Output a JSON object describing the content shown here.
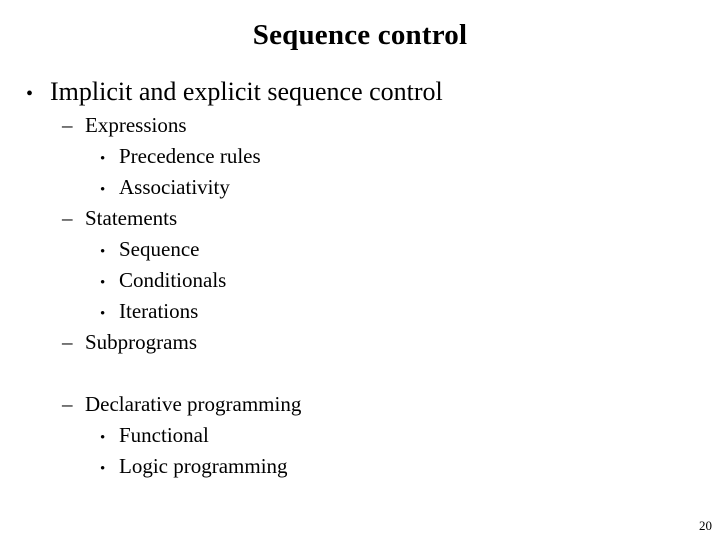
{
  "slide": {
    "title": "Sequence control",
    "page_number": "20",
    "markers": {
      "level1": "•",
      "level2": "–",
      "level3": "•"
    },
    "colors": {
      "background": "#ffffff",
      "text": "#000000"
    },
    "outline": [
      {
        "level": 1,
        "text": "Implicit and explicit sequence control"
      },
      {
        "level": 2,
        "text": "Expressions"
      },
      {
        "level": 3,
        "text": "Precedence rules"
      },
      {
        "level": 3,
        "text": "Associativity"
      },
      {
        "level": 2,
        "text": "Statements"
      },
      {
        "level": 3,
        "text": "Sequence"
      },
      {
        "level": 3,
        "text": "Conditionals"
      },
      {
        "level": 3,
        "text": "Iterations"
      },
      {
        "level": 2,
        "text": "Subprograms"
      },
      {
        "level": 0,
        "text": ""
      },
      {
        "level": 2,
        "text": "Declarative programming"
      },
      {
        "level": 3,
        "text": "Functional"
      },
      {
        "level": 3,
        "text": "Logic programming"
      }
    ]
  }
}
